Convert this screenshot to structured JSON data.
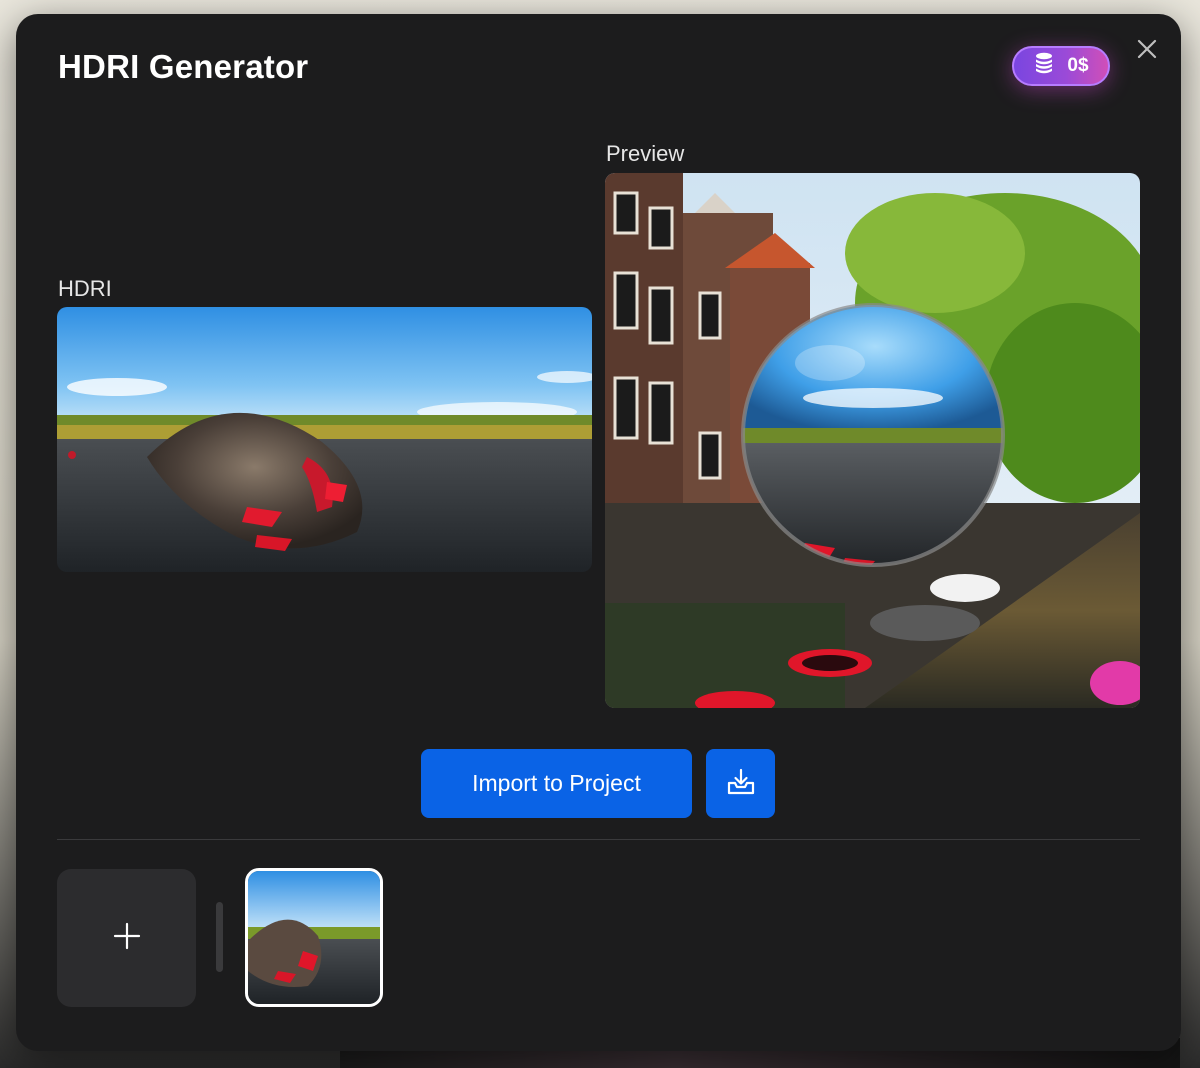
{
  "modal": {
    "title": "HDRI Generator",
    "credits": "0$",
    "colors": {
      "background": "#1c1c1d",
      "accent": "#0a63e6",
      "credits_gradient_start": "#7a46e0",
      "credits_gradient_end": "#d04fb8"
    }
  },
  "hdri_section": {
    "label": "HDRI"
  },
  "preview_section": {
    "label": "Preview"
  },
  "actions": {
    "import_label": "Import to Project",
    "download_icon": "download-tray-icon"
  },
  "library": {
    "add_icon": "plus-icon",
    "thumbnails": 1
  },
  "icons": {
    "close": "close-icon",
    "credits": "coin-stack-icon"
  }
}
